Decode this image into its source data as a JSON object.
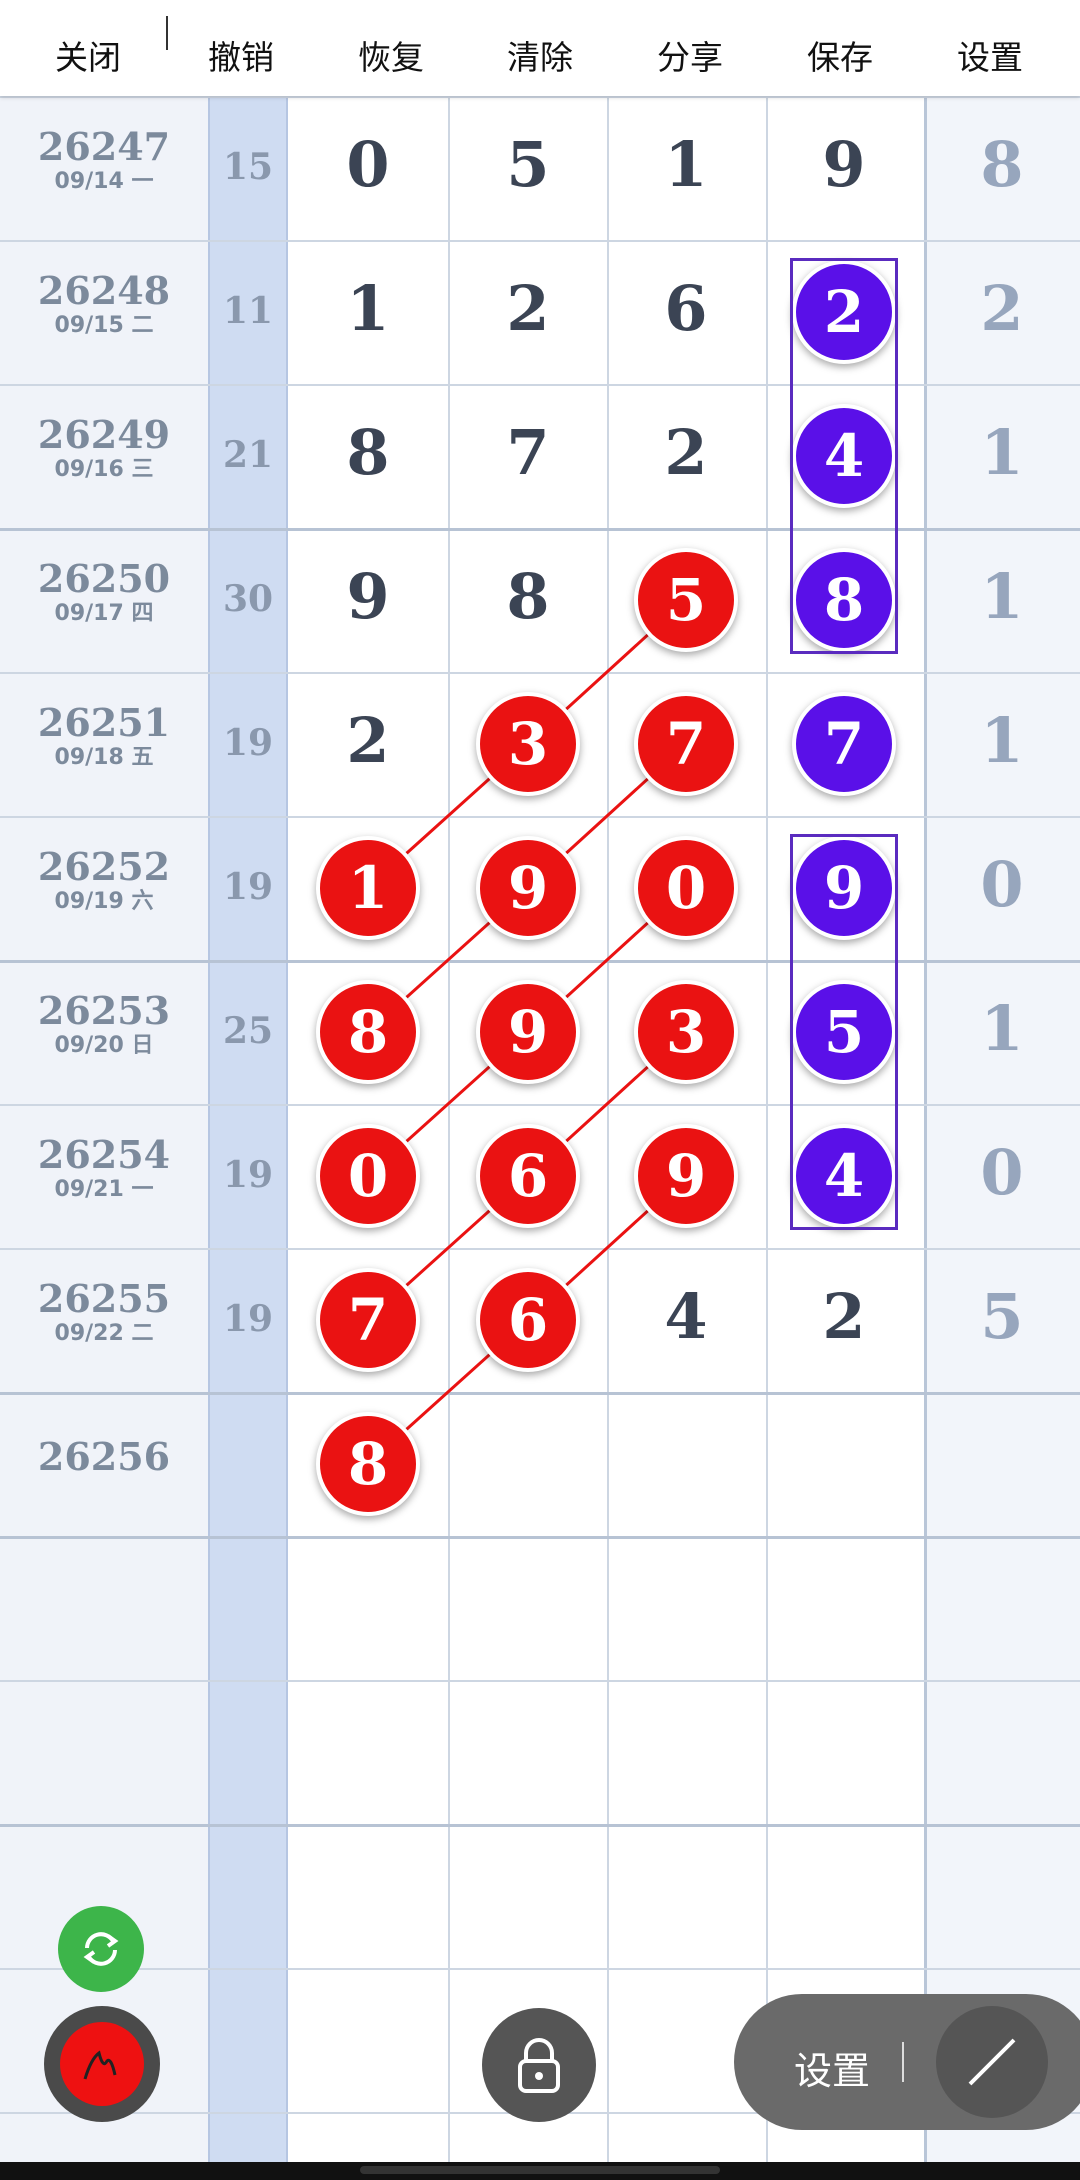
{
  "toolbar": {
    "close": "关闭",
    "undo": "撤销",
    "redo": "恢复",
    "clear": "清除",
    "share": "分享",
    "save": "保存",
    "settings": "设置"
  },
  "rows": [
    {
      "issue": "26247",
      "date": "09/14 一",
      "sum": "15",
      "n": [
        "0",
        "5",
        "1",
        "9"
      ],
      "last": "8"
    },
    {
      "issue": "26248",
      "date": "09/15 二",
      "sum": "11",
      "n": [
        "1",
        "2",
        "6",
        "2"
      ],
      "last": "2"
    },
    {
      "issue": "26249",
      "date": "09/16 三",
      "sum": "21",
      "n": [
        "8",
        "7",
        "2",
        "4"
      ],
      "last": "1"
    },
    {
      "issue": "26250",
      "date": "09/17 四",
      "sum": "30",
      "n": [
        "9",
        "8",
        "5",
        "8"
      ],
      "last": "1"
    },
    {
      "issue": "26251",
      "date": "09/18 五",
      "sum": "19",
      "n": [
        "2",
        "3",
        "7",
        "7"
      ],
      "last": "1"
    },
    {
      "issue": "26252",
      "date": "09/19 六",
      "sum": "19",
      "n": [
        "1",
        "9",
        "0",
        "9"
      ],
      "last": "0"
    },
    {
      "issue": "26253",
      "date": "09/20 日",
      "sum": "25",
      "n": [
        "8",
        "9",
        "3",
        "5"
      ],
      "last": "1"
    },
    {
      "issue": "26254",
      "date": "09/21 一",
      "sum": "19",
      "n": [
        "0",
        "6",
        "9",
        "4"
      ],
      "last": "0"
    },
    {
      "issue": "26255",
      "date": "09/22 二",
      "sum": "19",
      "n": [
        "7",
        "6",
        "4",
        "2"
      ],
      "last": "5"
    },
    {
      "issue": "26256",
      "date": "",
      "sum": "",
      "n": [
        "8",
        "",
        "",
        ""
      ],
      "last": ""
    }
  ],
  "highlight_colors": {
    "red": "#ea1212",
    "purple": "#5a10e8"
  },
  "floating": {
    "settings_label": "设置",
    "refresh_icon": "refresh-icon",
    "pen_icon": "pen-icon",
    "lock_icon": "lock-icon",
    "draw_line_icon": "draw-line-icon"
  }
}
